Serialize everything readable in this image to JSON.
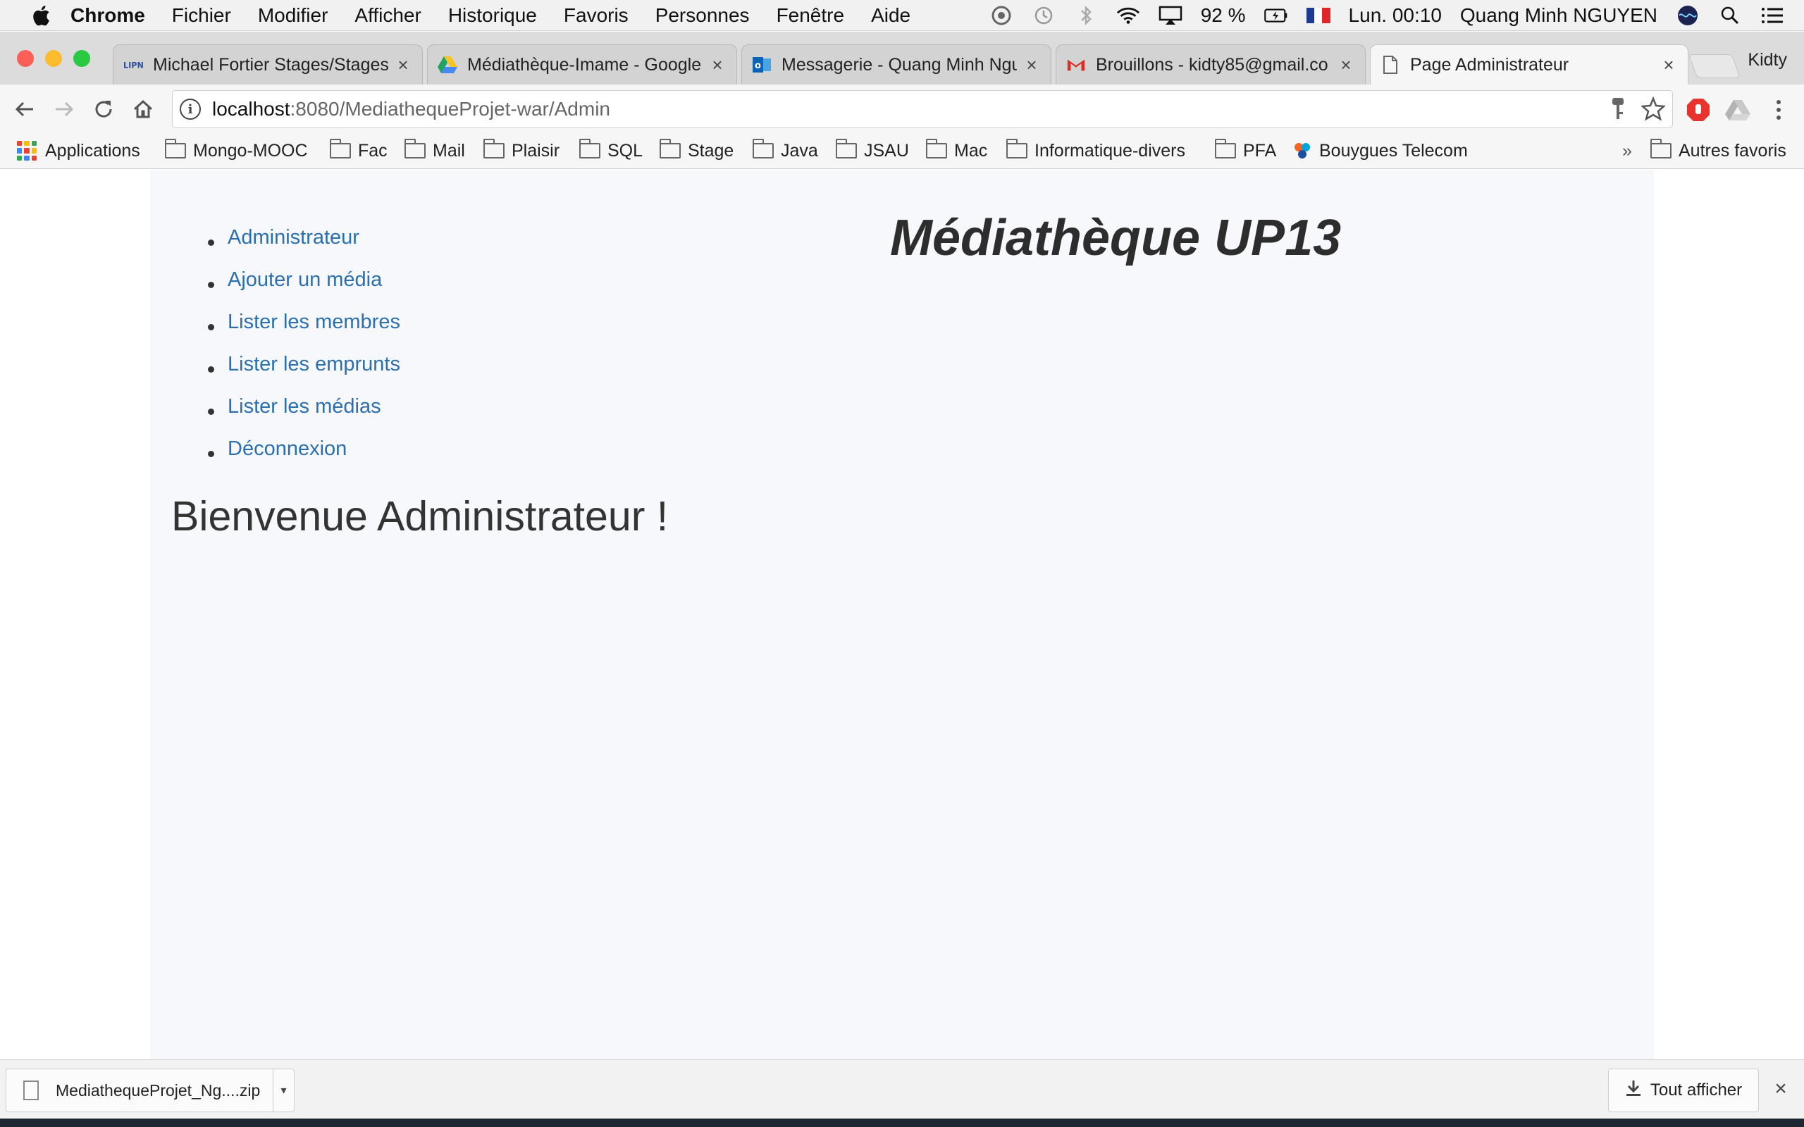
{
  "menubar": {
    "app_name": "Chrome",
    "menus": [
      "Fichier",
      "Modifier",
      "Afficher",
      "Historique",
      "Favoris",
      "Personnes",
      "Fenêtre",
      "Aide"
    ],
    "battery": "92 %",
    "clock": "Lun. 00:10",
    "user": "Quang Minh NGUYEN"
  },
  "tabs": [
    {
      "title": "Michael Fortier Stages/Stages",
      "favicon": "lipn-icon"
    },
    {
      "title": "Médiathèque-Imame - Google",
      "favicon": "google-drive-icon"
    },
    {
      "title": "Messagerie - Quang Minh Ngu",
      "favicon": "outlook-icon"
    },
    {
      "title": "Brouillons - kidty85@gmail.co",
      "favicon": "gmail-icon"
    },
    {
      "title": "Page Administrateur",
      "favicon": "document-icon",
      "active": true
    }
  ],
  "profile_name": "Kidty",
  "address": {
    "host": "localhost",
    "path": ":8080/MediathequeProjet-war/Admin"
  },
  "bookmarks": {
    "apps_label": "Applications",
    "folders": [
      "Mongo-MOOC",
      "Fac",
      "Mail",
      "Plaisir",
      "SQL",
      "Stage",
      "Java",
      "JSAU",
      "Mac",
      "Informatique-divers",
      "PFA"
    ],
    "link": "Bouygues Telecom",
    "overflow": "»",
    "other": "Autres favoris"
  },
  "page": {
    "heading": "Médiathèque UP13",
    "nav": [
      "Administrateur",
      "Ajouter un média",
      "Lister les membres",
      "Lister les emprunts",
      "Lister les médias",
      "Déconnexion"
    ],
    "welcome": "Bienvenue Administrateur !"
  },
  "downloads": {
    "file_name": "MediathequeProjet_Ng....zip",
    "show_all": "Tout afficher"
  },
  "colors": {
    "link": "#2a6fb0",
    "page_bg": "#f7f8fc",
    "close_red": "#fc5f57",
    "minimize_yellow": "#fdbc2e",
    "zoom_green": "#29c941"
  }
}
